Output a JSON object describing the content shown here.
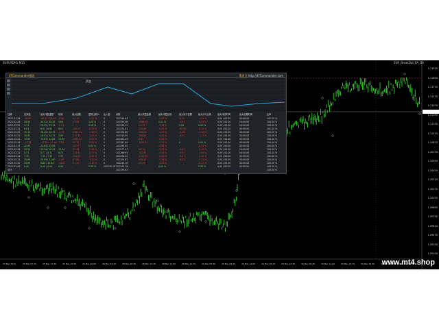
{
  "chart_window": {
    "symbol_top_left": "EURUSDH1,M15",
    "symbol_top_right": "EUR_BreakOut_EA_DA",
    "price_ticks": [
      "1.11920",
      "1.11850",
      "1.11710",
      "1.11570",
      "1.11430",
      "1.11290",
      "1.11150",
      "1.11010",
      "1.10870",
      "1.10730",
      "1.10590",
      "1.10450",
      "1.10310",
      "1.10170",
      "1.10030",
      "1.09890",
      "1.09750",
      "1.09610",
      "1.09470",
      "1.09330",
      "1.09190"
    ],
    "time_ticks": [
      "25 Mar 2022",
      "25 Mar 07:15",
      "25 Mar 11:30",
      "25 Mar 15:45",
      "25 Mar 20:00",
      "28 Mar 04:15",
      "28 Mar 08:30",
      "28 Mar 12:45",
      "28 Mar 17:00",
      "28 Mar 21:15",
      "29 Mar 05:30",
      "29 Mar 09:45",
      "29 Mar 14:00",
      "29 Mar 18:15",
      "29 Mar 22:30",
      "30 Mar 06:45",
      "30 Mar 11:00",
      "30 Mar 15:15",
      "30 Mar 19:30",
      "31 Mar 03:45",
      "31 Mar 08:00"
    ],
    "watermark": "www.mt4.shop"
  },
  "report": {
    "title": "4TCommander报告",
    "link_label": "黑龙江",
    "link_url": "http://4TCommander.com",
    "equity_label": "资金",
    "headers": [
      "日期",
      "日净值",
      "最大浮盈金额",
      "利润",
      "最大回撤",
      "盈利比例%",
      "出入金",
      "余额",
      "最大浮盈金额",
      "最大浮盈比例",
      "最大浮亏金额",
      "最大浮亏比例",
      "最大持仓时间",
      "最大回撤时间",
      "比率"
    ],
    "rows": [
      [
        "2022.03.29",
        "-18.85",
        "-58.32 / 59.83",
        "-8.88",
        "-11.13",
        "-1.12 %",
        "0",
        "102339.63",
        "-17.72",
        "-0.23 %",
        "-0.21",
        "-1.03 %",
        "0.00 / 00.00",
        "00:00:00",
        "100.00 %"
      ],
      [
        "2022.03.28",
        "20.00",
        "34.52 / 36.45",
        "3.64",
        "-11.06",
        "1.00 %",
        "0",
        "102359.48",
        "-1086.06",
        "2.11 %",
        "-1.06",
        "-0.03 %",
        "0.00 / 00.00",
        "00:00:00",
        "100.00 %"
      ],
      [
        "2022.03.25",
        "4.71",
        "20.52 / 33.14",
        "-2.03",
        "-",
        "0.08 %",
        "0",
        "102339.32",
        "-24.93",
        "-3.16 %",
        "0.00",
        "0.00 %",
        "0.00 / 00.00",
        "00:00:00",
        "100.00 %"
      ],
      [
        "2022.03.24",
        "6.01",
        "6.01 / 6.01",
        "6.01",
        "-100.07",
        "-0.17 %",
        "0",
        "102334.61",
        "-224.48",
        "-0.41 %",
        "-82.36",
        "-0.12 %",
        "0.00 / 00.00",
        "00:00:00",
        "100.00 %"
      ],
      [
        "2022.03.23",
        "15.10",
        "16.45 / 15.73",
        "-1.37",
        "-1187.21",
        "-1.18 %",
        "0",
        "102328.60",
        "-2097.2",
        "-1.17 %",
        "-0.16",
        "-1.16 %",
        "0.00 / 00.00",
        "00:00:00",
        "100.00 %"
      ],
      [
        "2022.03.22",
        "10.91",
        "16.91 / 10.73",
        "3.09",
        "-115.75",
        "-1.09 %",
        "0",
        "102313.50",
        "-168.80",
        "-4.00 %",
        "-4.30",
        "-1.17 %",
        "0.00 / 00.00",
        "00:00:00",
        "100.00 %"
      ],
      [
        "2022.03.21",
        "14.65",
        "14.65 / 14.65",
        "14.65",
        "-1080.01",
        "-1.01 %",
        "0",
        "102302.59",
        "-6.65",
        "-0.10 %",
        "-",
        "-",
        "0.00 / 00.00",
        "00:00:00",
        "100.00 %"
      ],
      [
        "2022.03.18",
        "-11.98",
        "-11.98 / -11.98",
        "-2.05",
        "-52.32",
        "-0.02 %",
        "0",
        "102287.94",
        "-1045.41",
        "-0.71 %",
        "0",
        "0.00 %",
        "0.00 / 00.00",
        "00:00:00",
        "100.00 %"
      ],
      [
        "2022.03.17",
        "22.65",
        "22.65 / 23.63",
        "-",
        "-14.57",
        "0.04 %",
        "0",
        "102299.92",
        "-",
        "-0.38 %",
        "-",
        "-0.11 %",
        "0.00 / 00.00",
        "00:00:00",
        "100.00 %"
      ],
      [
        "2022.03.16",
        "10.34",
        "10.34 / 10.34",
        "10.34",
        "-72.38",
        "-0.16 %",
        "0",
        "102277.27",
        "-50.72",
        "-0.34 %",
        "-0.92",
        "-0.10 %",
        "0.00 / 00.00",
        "00:00:00",
        "100.00 %"
      ],
      [
        "2022.03.15",
        "8.71",
        "8.71 / 8.71",
        "8.71",
        "-103.91",
        "-0.17 %",
        "0",
        "102266.93",
        "-102.93",
        "-0.10 %",
        "-1.32",
        "-1.06 %",
        "0.00 / 00.00",
        "00:00:00",
        "100.00 %"
      ],
      [
        "2022.03.14",
        "7.35",
        "7.35 / 7.35",
        "7.35",
        "-104.05",
        "-0.10 %",
        "0",
        "102258.22",
        "-1120.93",
        "-0.24 %",
        "-3.41",
        "-1.10 %",
        "0.00 / 00.00",
        "00:00:00",
        "100.00 %"
      ],
      [
        "2022.03.11",
        "10.69",
        "10.69 / 11.60",
        "-2.00",
        "-81.85",
        "-1.11 %",
        "0",
        "102250.87",
        "-858.23",
        "-0.16 %",
        "-9.11",
        "-1.11 %",
        "0.00 / 00.00",
        "00:00:00",
        "100.00 %"
      ],
      [
        "2022.03.10",
        "20.69",
        "8.80 / 10.69",
        "-78.87",
        "-71.15",
        "-2.10 %",
        "0",
        "102240.18",
        "-27.95",
        "-0.13 %",
        "-",
        "-0.11 %",
        "0.00 / 00.00",
        "00:00:00",
        "100.00 %"
      ],
      [
        "2022.03.09",
        "0.00",
        "0.00 / 0.00",
        "0.00",
        "-",
        "0.00 %",
        "102240.18",
        "102240.18",
        "-",
        "0.00 %",
        "-",
        "0.00 %",
        "0.00 / 00.00",
        "00:00:00",
        "100.00 %"
      ]
    ],
    "footer": [
      "总计",
      "",
      "",
      "",
      "",
      "",
      "",
      "102339.63",
      "",
      "",
      "",
      "",
      "",
      "",
      "100.00 %"
    ]
  }
}
